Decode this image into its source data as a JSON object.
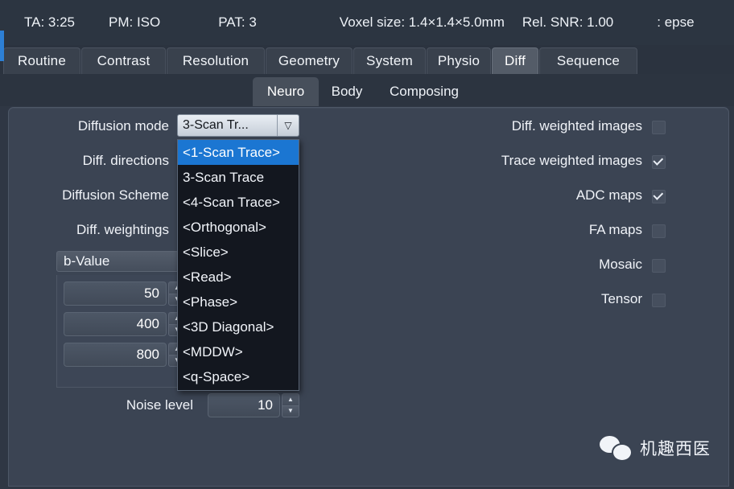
{
  "status_bar": {
    "ta": "TA: 3:25",
    "pm": "PM: ISO",
    "pat": "PAT: 3",
    "voxel": "Voxel size: 1.4×1.4×5.0mm",
    "snr": "Rel. SNR: 1.00",
    "sequence": ": epse"
  },
  "tabs": [
    {
      "label": "Routine",
      "selected": false
    },
    {
      "label": "Contrast",
      "selected": false
    },
    {
      "label": "Resolution",
      "selected": false
    },
    {
      "label": "Geometry",
      "selected": false
    },
    {
      "label": "System",
      "selected": false
    },
    {
      "label": "Physio",
      "selected": false
    },
    {
      "label": "Diff",
      "selected": true
    },
    {
      "label": "Sequence",
      "selected": false
    }
  ],
  "subtabs": [
    {
      "label": "Neuro",
      "selected": true
    },
    {
      "label": "Body",
      "selected": false
    },
    {
      "label": "Composing",
      "selected": false
    }
  ],
  "left_form": {
    "labels": {
      "diffusion_mode": "Diffusion mode",
      "diff_directions": "Diff. directions",
      "diffusion_scheme": "Diffusion Scheme",
      "diff_weightings": "Diff. weightings",
      "noise_level": "Noise level"
    },
    "combo": {
      "value": "3-Scan Tr...",
      "arrow_icon": "chevron-down-icon"
    },
    "dropdown_options": [
      {
        "label": "<1-Scan Trace>",
        "highlighted": true
      },
      {
        "label": "3-Scan Trace",
        "highlighted": false
      },
      {
        "label": "<4-Scan Trace>",
        "highlighted": false
      },
      {
        "label": "<Orthogonal>",
        "highlighted": false
      },
      {
        "label": "<Slice>",
        "highlighted": false
      },
      {
        "label": "<Read>",
        "highlighted": false
      },
      {
        "label": "<Phase>",
        "highlighted": false
      },
      {
        "label": "<3D Diagonal>",
        "highlighted": false
      },
      {
        "label": "<MDDW>",
        "highlighted": false
      },
      {
        "label": "<q-Space>",
        "highlighted": false
      }
    ],
    "bvalue_table": {
      "header": "b-Value",
      "rows": [
        "50",
        "400",
        "800"
      ]
    },
    "noise_level_value": "10",
    "spinner_up_icon": "caret-up-icon",
    "spinner_down_icon": "caret-down-icon"
  },
  "right_form": {
    "options": [
      {
        "label": "Diff. weighted images",
        "checked": false
      },
      {
        "label": "Trace weighted images",
        "checked": true
      },
      {
        "label": "ADC maps",
        "checked": true
      },
      {
        "label": "FA maps",
        "checked": false
      },
      {
        "label": "Mosaic",
        "checked": false
      },
      {
        "label": "Tensor",
        "checked": false
      }
    ]
  },
  "watermark": {
    "icon": "wechat-icon",
    "text": "机趣西医"
  },
  "colors": {
    "accent_blue": "#2d7fd4",
    "highlight_blue": "#1b76d2",
    "panel_bg": "#3b4453",
    "window_bg": "#2f3744",
    "status_bg": "#2c3541",
    "dropdown_bg": "#13171f"
  }
}
